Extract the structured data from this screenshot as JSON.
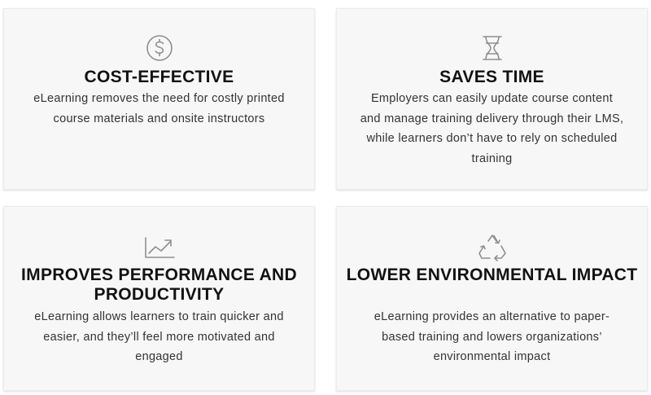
{
  "cards": [
    {
      "icon": "dollar-coin-icon",
      "title": "COST-EFFECTIVE",
      "description": "eLearning removes the need for costly printed course materials and onsite instructors"
    },
    {
      "icon": "hourglass-icon",
      "title": "SAVES TIME",
      "description": "Employers can easily update course content and manage training delivery through their LMS, while learners don’t have to rely on scheduled training"
    },
    {
      "icon": "trend-up-icon",
      "title": "IMPROVES PERFORMANCE AND PRODUCTIVITY",
      "description": "eLearning allows learners to train quicker and easier, and they’ll feel more motivated and engaged"
    },
    {
      "icon": "recycle-icon",
      "title": "LOWER ENVIRONMENTAL IMPACT",
      "description": "eLearning provides an alternative to paper-based training and lowers organizations’ environmental impact"
    }
  ],
  "colors": {
    "card_background": "#f7f7f7",
    "title": "#121212",
    "text": "#333333",
    "icon": "#8f8f8f"
  }
}
